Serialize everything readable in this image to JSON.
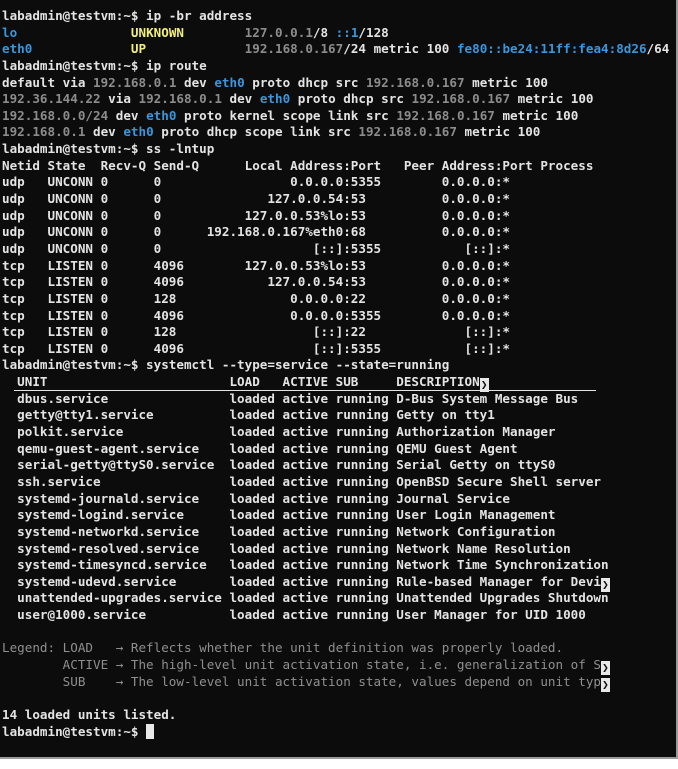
{
  "terminal": {
    "chevron_glyph": "❯",
    "lines": [
      [
        {
          "t": "labadmin@testvm:~$ ip -br address",
          "c": "w"
        }
      ],
      [
        {
          "t": "lo               ",
          "c": "b"
        },
        {
          "t": "UNKNOWN",
          "c": "y"
        },
        {
          "t": "        ",
          "c": "w"
        },
        {
          "t": "127.0.0.1",
          "c": "g"
        },
        {
          "t": "/8 ",
          "c": "w"
        },
        {
          "t": "::1",
          "c": "b"
        },
        {
          "t": "/128",
          "c": "w"
        }
      ],
      [
        {
          "t": "eth0             ",
          "c": "b"
        },
        {
          "t": "UP",
          "c": "y"
        },
        {
          "t": "             ",
          "c": "w"
        },
        {
          "t": "192.168.0.167",
          "c": "g"
        },
        {
          "t": "/24 metric 100 ",
          "c": "w"
        },
        {
          "t": "fe80::be24:11ff:fea4:8d26",
          "c": "b"
        },
        {
          "t": "/64",
          "c": "w"
        }
      ],
      [
        {
          "t": "labadmin@testvm:~$ ip route",
          "c": "w"
        }
      ],
      [
        {
          "t": "default via ",
          "c": "w"
        },
        {
          "t": "192.168.0.1",
          "c": "g"
        },
        {
          "t": " dev ",
          "c": "w"
        },
        {
          "t": "eth0",
          "c": "b"
        },
        {
          "t": " proto dhcp src ",
          "c": "w"
        },
        {
          "t": "192.168.0.167",
          "c": "g"
        },
        {
          "t": " metric 100",
          "c": "w"
        }
      ],
      [
        {
          "t": "192.36.144.22",
          "c": "g"
        },
        {
          "t": " via ",
          "c": "w"
        },
        {
          "t": "192.168.0.1",
          "c": "g"
        },
        {
          "t": " dev ",
          "c": "w"
        },
        {
          "t": "eth0",
          "c": "b"
        },
        {
          "t": " proto dhcp src ",
          "c": "w"
        },
        {
          "t": "192.168.0.167",
          "c": "g"
        },
        {
          "t": " metric 100",
          "c": "w"
        }
      ],
      [
        {
          "t": "192.168.0.0/24",
          "c": "g"
        },
        {
          "t": " dev ",
          "c": "w"
        },
        {
          "t": "eth0",
          "c": "b"
        },
        {
          "t": " proto kernel scope link src ",
          "c": "w"
        },
        {
          "t": "192.168.0.167",
          "c": "g"
        },
        {
          "t": " metric 100",
          "c": "w"
        }
      ],
      [
        {
          "t": "192.168.0.1",
          "c": "g"
        },
        {
          "t": " dev ",
          "c": "w"
        },
        {
          "t": "eth0",
          "c": "b"
        },
        {
          "t": " proto dhcp scope link src ",
          "c": "w"
        },
        {
          "t": "192.168.0.167",
          "c": "g"
        },
        {
          "t": " metric 100",
          "c": "w"
        }
      ],
      [
        {
          "t": "labadmin@testvm:~$ ss -lntup",
          "c": "w"
        }
      ],
      [
        {
          "t": "Netid State  Recv-Q Send-Q      Local Address:Port   Peer Address:Port Process",
          "c": "w"
        }
      ],
      [
        {
          "t": "udp   UNCONN 0      0                 0.0.0.0:5355        0.0.0.0:*",
          "c": "w"
        }
      ],
      [
        {
          "t": "udp   UNCONN 0      0              127.0.0.54:53          0.0.0.0:*",
          "c": "w"
        }
      ],
      [
        {
          "t": "udp   UNCONN 0      0           127.0.0.53%lo:53          0.0.0.0:*",
          "c": "w"
        }
      ],
      [
        {
          "t": "udp   UNCONN 0      0      192.168.0.167%eth0:68          0.0.0.0:*",
          "c": "w"
        }
      ],
      [
        {
          "t": "udp   UNCONN 0      0                    [::]:5355           [::]:*",
          "c": "w"
        }
      ],
      [
        {
          "t": "tcp   LISTEN 0      4096        127.0.0.53%lo:53          0.0.0.0:*",
          "c": "w"
        }
      ],
      [
        {
          "t": "tcp   LISTEN 0      4096           127.0.0.54:53          0.0.0.0:*",
          "c": "w"
        }
      ],
      [
        {
          "t": "tcp   LISTEN 0      128               0.0.0.0:22          0.0.0.0:*",
          "c": "w"
        }
      ],
      [
        {
          "t": "tcp   LISTEN 0      4096              0.0.0.0:5355        0.0.0.0:*",
          "c": "w"
        }
      ],
      [
        {
          "t": "tcp   LISTEN 0      128                  [::]:22             [::]:*",
          "c": "w"
        }
      ],
      [
        {
          "t": "tcp   LISTEN 0      4096                 [::]:5355           [::]:*",
          "c": "w"
        }
      ],
      [
        {
          "t": "labadmin@testvm:~$ systemctl --type=service --state=running",
          "c": "w"
        }
      ],
      [
        {
          "t": "  UNIT                        LOAD   ACTIVE SUB     DESCRIPTION",
          "c": "w"
        },
        {
          "chev": true
        }
      ],
      [
        {
          "t": "  dbus.service                loaded active running D-Bus System Message Bus",
          "c": "w"
        }
      ],
      [
        {
          "t": "  getty@tty1.service          loaded active running Getty on tty1",
          "c": "w"
        }
      ],
      [
        {
          "t": "  polkit.service              loaded active running Authorization Manager",
          "c": "w"
        }
      ],
      [
        {
          "t": "  qemu-guest-agent.service    loaded active running QEMU Guest Agent",
          "c": "w"
        }
      ],
      [
        {
          "t": "  serial-getty@ttyS0.service  loaded active running Serial Getty on ttyS0",
          "c": "w"
        }
      ],
      [
        {
          "t": "  ssh.service                 loaded active running OpenBSD Secure Shell server",
          "c": "w"
        }
      ],
      [
        {
          "t": "  systemd-journald.service    loaded active running Journal Service",
          "c": "w"
        }
      ],
      [
        {
          "t": "  systemd-logind.service      loaded active running User Login Management",
          "c": "w"
        }
      ],
      [
        {
          "t": "  systemd-networkd.service    loaded active running Network Configuration",
          "c": "w"
        }
      ],
      [
        {
          "t": "  systemd-resolved.service    loaded active running Network Name Resolution",
          "c": "w"
        }
      ],
      [
        {
          "t": "  systemd-timesyncd.service   loaded active running Network Time Synchronization",
          "c": "w"
        }
      ],
      [
        {
          "t": "  systemd-udevd.service       loaded active running Rule-based Manager for Devi",
          "c": "w"
        },
        {
          "chev": true
        }
      ],
      [
        {
          "t": "  unattended-upgrades.service loaded active running Unattended Upgrades Shutdown",
          "c": "w"
        }
      ],
      [
        {
          "t": "  user@1000.service           loaded active running User Manager for UID 1000",
          "c": "w"
        }
      ],
      [
        {
          "t": "",
          "c": "w"
        }
      ],
      [
        {
          "t": "Legend: LOAD   → Reflects whether the unit definition was properly loaded.",
          "c": "k"
        }
      ],
      [
        {
          "t": "        ACTIVE → The high-level unit activation state, i.e. generalization of S",
          "c": "k"
        },
        {
          "chev": true
        }
      ],
      [
        {
          "t": "        SUB    → The low-level unit activation state, values depend on unit typ",
          "c": "k"
        },
        {
          "chev": true
        }
      ],
      [
        {
          "t": "",
          "c": "w"
        }
      ],
      [
        {
          "t": "14 loaded units listed.",
          "c": "w"
        }
      ],
      [
        {
          "t": "labadmin@testvm:~$ ",
          "c": "w"
        },
        {
          "cursor": true
        }
      ]
    ]
  }
}
